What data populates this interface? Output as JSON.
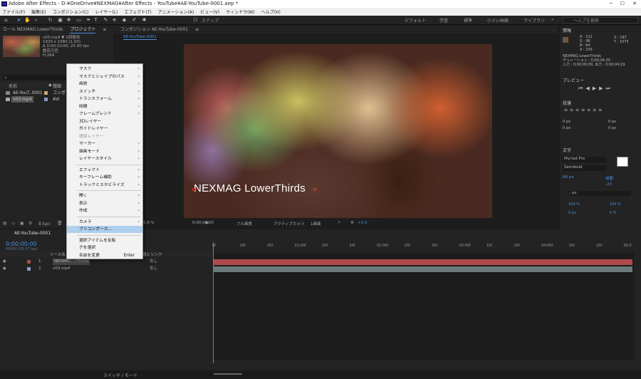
{
  "window": {
    "title": "Adobe After Effects - D:¥OneDrive¥NEXMAG¥After Effects - YouTube¥AE-YouTube-0001.aep *",
    "icon": "Ae"
  },
  "menubar": [
    "ファイル(F)",
    "編集(E)",
    "コンポジション(C)",
    "レイヤー(L)",
    "エフェクト(T)",
    "アニメーション(A)",
    "ビュー(V)",
    "ウィンドウ(W)",
    "ヘルプ(H)"
  ],
  "toolbar": {
    "snap": "スナップ",
    "workspaces": [
      "デフォルト",
      "学習",
      "標準",
      "小さい画面",
      "ライブラリ"
    ],
    "search_placeholder": "ヘルプを検索"
  },
  "left_panel": {
    "effect_controls_tab": "ロール NEXMAG LowerThirds",
    "project_tab": "プロジェクト",
    "file_name": "v03.mp4 ▼",
    "usage": "1回使用",
    "resolution": "1920 x 1080 (1.00)",
    "duration": "Δ 0;00;10;00, 25.00 fps",
    "color": "数百万色",
    "codec": "H.264",
    "col_name": "名前",
    "col_type": "種類",
    "items": [
      {
        "name": "AE-YouT..0001",
        "type": "コンポ"
      },
      {
        "name": "v03.mp4",
        "type": "AVI"
      }
    ],
    "bpc": "8 bpc"
  },
  "comp_panel": {
    "tab": "コンポジション AE-YouTube-0001",
    "subtab": "AE-YouTube-0001",
    "lower_third": "NEXMAG LowerThirds",
    "zoom": "5.9 %",
    "time": "0;00;00;00",
    "quality": "フル画質",
    "camera": "アクティブカメラ",
    "views": "1画面",
    "exposure": "+0.0"
  },
  "right_panel": {
    "info_title": "情報",
    "r": "R : 111",
    "g": "G : 86",
    "b": "B : 64",
    "a": "A : 255",
    "x": "X : 187",
    "y": "Y : 1075",
    "layer": "NEXMAG LowerThirds",
    "duration_line": "デュレーション : 0;00;04;30",
    "inout_line": "入力 : 0;00;00;00, 出力 : 0;00;04;29",
    "preview_title": "プレビュー",
    "align_title": "段落",
    "px_values": [
      "0 px",
      "0 px",
      "0 px",
      "0 px",
      "0 px",
      "0 px"
    ],
    "char_title": "文字",
    "font": "Myriad Pro",
    "style": "Semibold",
    "size": "86 px",
    "leading": "自動",
    "tracking": "-23",
    "unit": "- px",
    "scale": [
      "100 %",
      "100 %"
    ],
    "shift": [
      "0 px",
      "0 %"
    ]
  },
  "timeline": {
    "tab": "AE-YouTube-0001",
    "timecode": "0;00;00;00",
    "frames": "00000 (29.97 fps)",
    "col_source": "ソース名",
    "col_parent": "親とリンク",
    "ticks": [
      "0f",
      "10f",
      "20f",
      "01:00f",
      "10f",
      "20f",
      "02:00f",
      "10f",
      "20f",
      "03:00f",
      "10f",
      "20f",
      "04:00f",
      "10f",
      "20f",
      "05:0"
    ],
    "layers": [
      {
        "num": "1",
        "name": "NEXMAG...rThirds",
        "parent": "なし"
      },
      {
        "num": "2",
        "name": "v03.mp4",
        "parent": "なし"
      }
    ],
    "switch_mode": "スイッチ / モード"
  },
  "context_menu": [
    {
      "label": "マスク",
      "arrow": true
    },
    {
      "label": "マスクとシェイプのパス",
      "arrow": true
    },
    {
      "label": "画質",
      "arrow": true
    },
    {
      "label": "スイッチ",
      "arrow": true
    },
    {
      "label": "トランスフォーム",
      "arrow": true
    },
    {
      "label": "時間",
      "arrow": true
    },
    {
      "label": "フレームブレンド",
      "arrow": true
    },
    {
      "label": "3Dレイヤー",
      "arrow": false
    },
    {
      "label": "ガイドレイヤー",
      "arrow": false
    },
    {
      "label": "環境レイヤー",
      "arrow": false,
      "disabled": true
    },
    {
      "label": "マーカー",
      "arrow": true
    },
    {
      "label": "描画モード",
      "arrow": true
    },
    {
      "label": "レイヤースタイル",
      "arrow": true
    },
    {
      "sep": true
    },
    {
      "label": "エフェクト",
      "arrow": true
    },
    {
      "label": "キーフレーム補助",
      "arrow": true
    },
    {
      "label": "トラックとスタビライズ",
      "arrow": true
    },
    {
      "sep": true
    },
    {
      "label": "開く",
      "arrow": true
    },
    {
      "label": "表示",
      "arrow": true
    },
    {
      "label": "作成",
      "arrow": true
    },
    {
      "sep": true
    },
    {
      "label": "カメラ",
      "arrow": true
    },
    {
      "label": "プリコンポーズ...",
      "arrow": false,
      "highlight": true
    },
    {
      "sep": true
    },
    {
      "label": "選択アイテムを反転",
      "arrow": false
    },
    {
      "label": "子を選択",
      "arrow": false
    },
    {
      "label": "名前を変更",
      "arrow": false,
      "shortcut": "Enter"
    }
  ]
}
